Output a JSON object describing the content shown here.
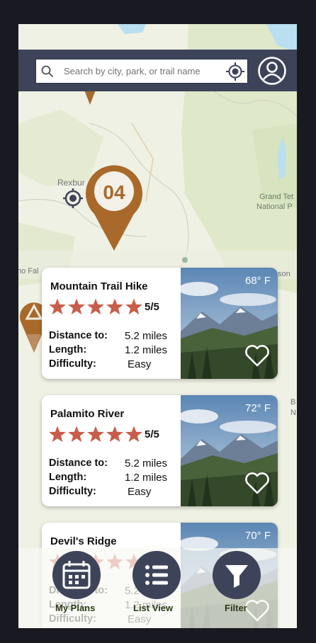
{
  "search": {
    "placeholder": "Search by city, park, or trail name"
  },
  "map": {
    "marker_number": "04",
    "labels": {
      "town": "Rexbur",
      "park_line1": "Grand Tet",
      "park_line2": "National P",
      "left_place": "ho Fal",
      "right_place": "son",
      "right_place2": "B",
      "right_place3": "N"
    }
  },
  "cards": [
    {
      "title": "Mountain Trail Hike",
      "rating_text": "5/5",
      "stars": 5,
      "temperature": "68° F",
      "distance_label": "Distance to:",
      "distance": "5.2 miles",
      "length_label": "Length:",
      "length": "1.2 miles",
      "difficulty_label": "Difficulty:",
      "difficulty": "Easy"
    },
    {
      "title": "Palamito River",
      "rating_text": "5/5",
      "stars": 5,
      "temperature": "72° F",
      "distance_label": "Distance to:",
      "distance": "5.2 miles",
      "length_label": "Length:",
      "length": "1.2 miles",
      "difficulty_label": "Difficulty:",
      "difficulty": "Easy"
    },
    {
      "title": "Devil's Ridge",
      "rating_text": "5/5",
      "stars": 5,
      "temperature": "70° F",
      "distance_label": "Distance to:",
      "distance": "5.2 miles",
      "length_label": "Length:",
      "length": "1.2 miles",
      "difficulty_label": "Difficulty:",
      "difficulty": "Easy"
    }
  ],
  "nav": {
    "plans_label": "My Plans",
    "list_label": "List View",
    "filter_label": "Filter"
  },
  "colors": {
    "topbar": "#3d4459",
    "marker": "#a9692a",
    "star": "#c95d4b",
    "nav_label": "#2a3b16"
  }
}
